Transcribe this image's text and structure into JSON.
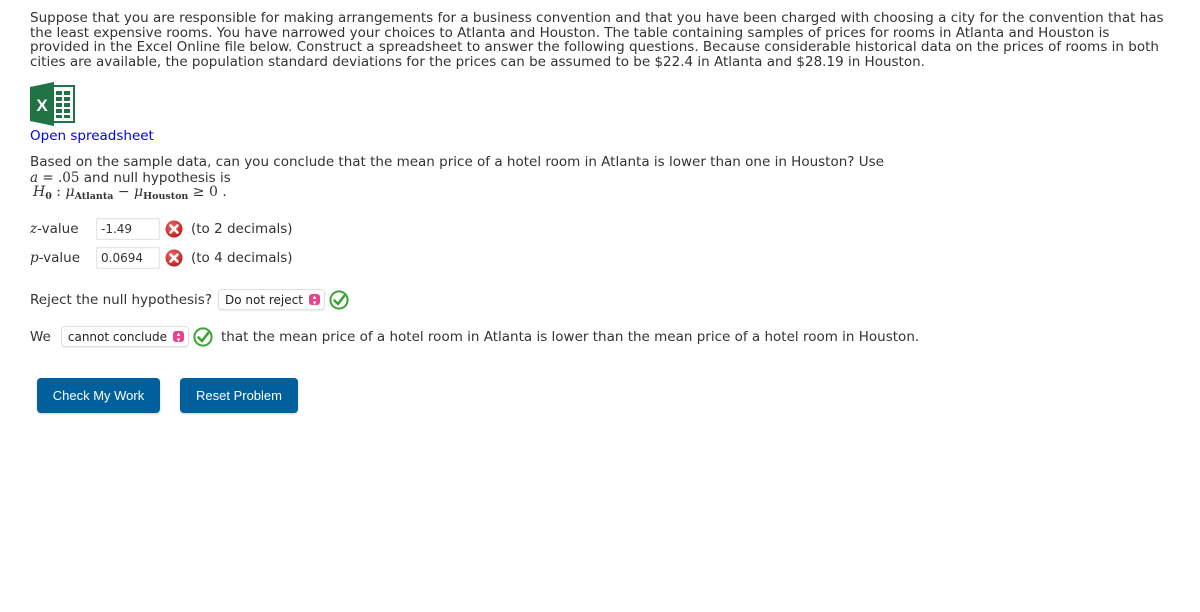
{
  "intro_text": "Suppose that you are responsible for making arrangements for a business convention and that you have been charged with choosing a city for the convention that has the least expensive rooms. You have narrowed your choices to Atlanta and Houston. The table containing samples of prices for rooms in Atlanta and Houston is provided in the Excel Online file below. Construct a spreadsheet to answer the following questions. Because considerable historical data on the prices of rooms in both cities are available, the population standard deviations for the prices can be assumed to be $22.4 in Atlanta and $28.19 in Houston.",
  "spreadsheet": {
    "icon": "excel-icon",
    "link_label": "Open spreadsheet",
    "brand_color": "#217346"
  },
  "question": {
    "text": "Based on the sample data, can you conclude that the mean price of a hotel room in Atlanta is lower than one in Houston? Use",
    "alpha_symbol": "a",
    "alpha_equals": " = ",
    "alpha_value": ".05",
    "alpha_suffix": " and null hypothesis is",
    "h0": {
      "H": "H",
      "zero_sub": "0",
      "colon": " : ",
      "mu": "μ",
      "sub_a": "Atlanta",
      "minus": " − ",
      "sub_h": "Houston",
      "rel": " ≥ ",
      "rhs": "0",
      "end": " ."
    }
  },
  "answers": {
    "z": {
      "label_var": "z",
      "label_suffix": "-value",
      "value": "-1.49",
      "status": "incorrect",
      "hint": "(to 2 decimals)"
    },
    "p": {
      "label_var": "p",
      "label_suffix": "-value",
      "value": "0.0694",
      "status": "incorrect",
      "hint": "(to 4 decimals)"
    },
    "reject": {
      "prompt": "Reject the null hypothesis?",
      "selected": "Do not reject",
      "status": "correct"
    },
    "conclusion": {
      "prefix": "We",
      "selected": "cannot conclude",
      "status": "correct",
      "suffix": "that the mean price of a hotel room in Atlanta is lower than the mean price of a hotel room in Houston."
    }
  },
  "buttons": {
    "check": "Check My Work",
    "reset": "Reset Problem"
  },
  "colors": {
    "button_bg": "#00609c",
    "link": "#0000ee",
    "incorrect": "#cc2222",
    "correct": "#3aa335",
    "select_caret": "#e8428a"
  }
}
